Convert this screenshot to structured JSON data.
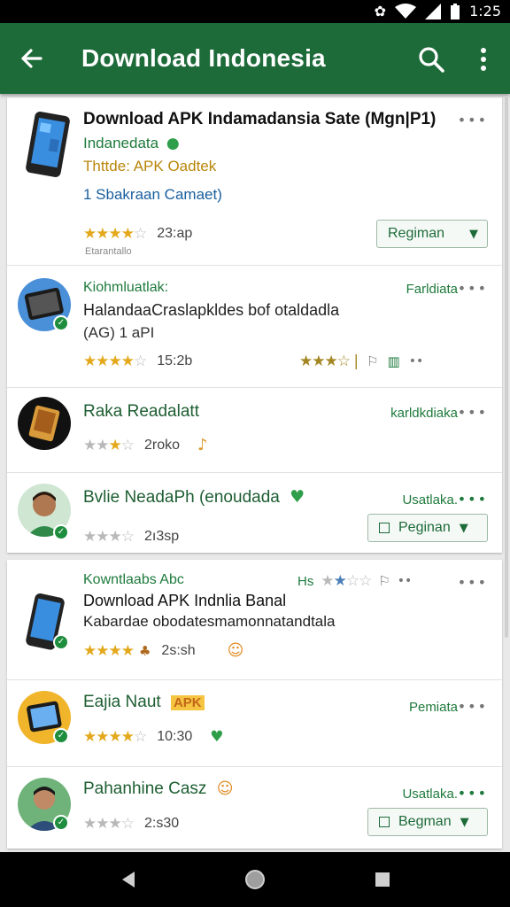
{
  "status_bar": {
    "time": "1:25"
  },
  "app_bar": {
    "title": "Download Indonesia"
  },
  "featured": {
    "title": "Download APK Indamadansia Sate (Mgn|P1)",
    "developer": "Indanedata",
    "subtitle": "Thttde: APK Oadtek",
    "link_text": "1 Sbakraan Camaet)",
    "rating": 4,
    "rating_value": "23:ap",
    "small_text": "Etarantallo",
    "action_label": "Regiman"
  },
  "card_a_items": [
    {
      "title": "Kiohmluatlak:",
      "line": "HalandaaCraslapkldes bof otaldadla",
      "sub": "(AG) 1 aPI",
      "rating": 4,
      "rating_value": "15:2b",
      "right_label": "Farldiata"
    },
    {
      "title": "Raka Readalatt",
      "rating": 3,
      "rating_value": "2roko",
      "right_label": "karldkdiaka"
    },
    {
      "title": "Bvlie NeadaPh (enoudada",
      "rating": 2,
      "rating_value": "2ı3sp",
      "right_label": "Usatlaka.",
      "action_label": "Peginan"
    }
  ],
  "card_b_items": [
    {
      "developer": "Kowntlaabs Abc",
      "title": "Download APK Indnlia Banal",
      "line": "Kabardae obodatesmamonnatandtala",
      "rating": 4,
      "rating_value": "2s:sh",
      "right_label": "Hs"
    },
    {
      "title": "Eajia Naut",
      "badge": "APK",
      "rating": 4,
      "rating_value": "10:30",
      "right_label": "Pemiata"
    },
    {
      "title": "Pahanhine Casz",
      "rating": 2,
      "rating_value": "2:s30",
      "right_label": "Usatlaka.",
      "action_label": "Begman"
    }
  ],
  "colors": {
    "app_bar": "#1e6b3a",
    "accent_green": "#1e7a3c",
    "star": "#e3a81b"
  }
}
